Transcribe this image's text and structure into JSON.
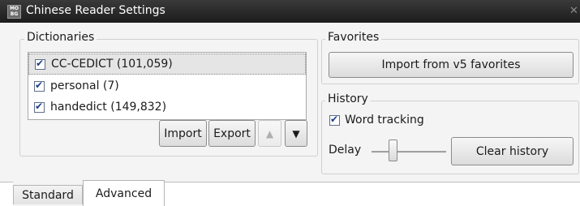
{
  "window": {
    "title": "Chinese Reader Settings",
    "app_icon_text": "MO BG"
  },
  "dictionaries": {
    "group_label": "Dictionaries",
    "items": [
      {
        "label": "CC-CEDICT (101,059)",
        "checked": true,
        "selected": true
      },
      {
        "label": "personal (7)",
        "checked": true,
        "selected": false
      },
      {
        "label": "handedict (149,832)",
        "checked": true,
        "selected": false
      }
    ],
    "import_label": "Import",
    "export_label": "Export",
    "move_up_icon": "triangle-up-icon",
    "move_down_icon": "triangle-down-icon"
  },
  "favorites": {
    "group_label": "Favorites",
    "import_label": "Import from v5 favorites"
  },
  "history": {
    "group_label": "History",
    "word_tracking_label": "Word tracking",
    "word_tracking_checked": true,
    "delay_label": "Delay",
    "clear_label": "Clear history"
  },
  "tabs": [
    {
      "label": "Standard",
      "active": false
    },
    {
      "label": "Advanced",
      "active": true
    }
  ]
}
